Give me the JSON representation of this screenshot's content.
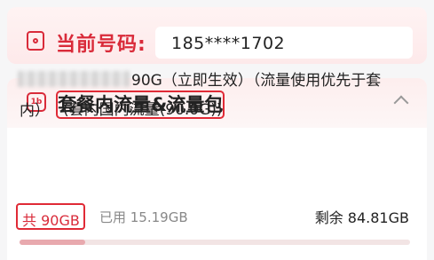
{
  "phone": {
    "label": "当前号码:",
    "value": "185****1702"
  },
  "section": {
    "title": "套餐内流量&流量包",
    "icon": "package-icon",
    "icon_glyph": "1b"
  },
  "package": {
    "name_suffix": "90G（立即生效）（流量使用优先于套",
    "line2_prefix": "内）",
    "quota_label": "(套内国内流量(90.0G))"
  },
  "usage": {
    "total": "共 90GB",
    "used": "已用 15.19GB",
    "remaining": "剩余 84.81GB",
    "used_fraction": 0.1688
  },
  "colors": {
    "accent": "#d92b3a",
    "highlight_border": "#e02a36"
  }
}
